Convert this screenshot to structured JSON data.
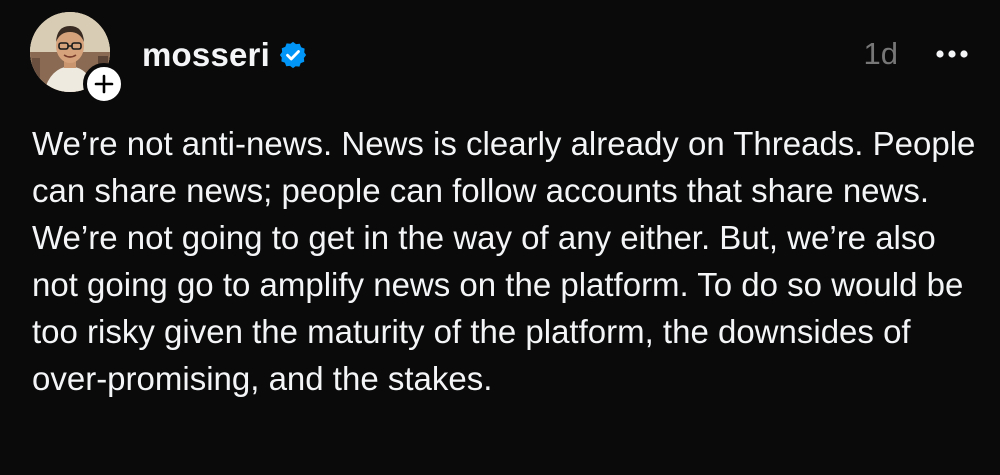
{
  "post": {
    "username": "mosseri",
    "timestamp": "1d",
    "verified": true,
    "text": "We’re not anti-news. News is clearly already on Threads. People can share news; people can follow accounts that share news. We’re not going to get in the way of any either. But, we’re also not going go to amplify news on the platform. To do so would be too risky given the maturity of the platform, the downsides of over-promising, and the stakes."
  },
  "icons": {
    "verified": "verified-badge-icon",
    "follow": "plus-icon",
    "more": "more-options-icon"
  },
  "colors": {
    "background": "#0a0a0a",
    "text": "#f3f5f7",
    "muted": "#777777",
    "verified_blue": "#0095f6"
  }
}
